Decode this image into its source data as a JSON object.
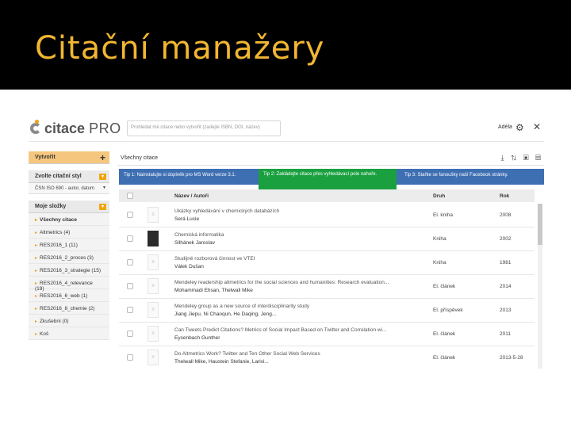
{
  "slide": {
    "title": "Citační manažery"
  },
  "app": {
    "logo_citace": "citace",
    "logo_pro": "PRO",
    "search_placeholder": "Prohledat mé citace nebo vytvořit (zadejte ISBN, DOI, název)",
    "user_name": "Adéla",
    "gear_icon": "⚙",
    "tools_icon": "✕"
  },
  "sidebar": {
    "create_label": "Vytvořit",
    "create_icon": "+",
    "style_label": "Zvolte citační styl",
    "style_value": "ČSN ISO 690 - autor, datum",
    "folders_label": "Moje složky",
    "folders": [
      "Všechny citace",
      "Altmetrics (4)",
      "RES2016_1 (11)",
      "RES2016_2_proces (3)",
      "RES2016_3_strategie (15)",
      "RES2016_4_relevance (19)",
      "RES2016_6_web (1)",
      "RES2016_8_chemie (2)",
      "Zkušební (0)",
      "Koš"
    ]
  },
  "main": {
    "heading": "Všechny citace",
    "toolbar_icons": "⤓ ⇅ ▣ ▤",
    "tips": [
      "Tip 1: Nainstalujte si doplněk pro MS Word verze 3.1.",
      "Tip 2: Zakládejte citace přes vyhledávací pole nahoře.",
      "Tip 3: Staňte se fanouškу naší Facebook stránky."
    ],
    "columns": {
      "name": "Název / Autoři",
      "type": "Druh",
      "year": "Rok"
    },
    "rows": [
      {
        "title": "Ukázky vyhledávání v chemických databázích",
        "authors": "Šerá Lucie",
        "type": "El. kniha",
        "year": "2008"
      },
      {
        "title": "Chemická informatika",
        "authors": "Šilhánek Jaroslav",
        "type": "Kniha",
        "year": "2002"
      },
      {
        "title": "Studijně rozborová činnost ve VTEI",
        "authors": "Válek Dušan",
        "type": "Kniha",
        "year": "1981"
      },
      {
        "title": "Mendeley readership altmetrics for the social sciences and humanities: Research evaluation...",
        "authors": "Mohammadi Ehsan, Thelwall Mike",
        "type": "El. článek",
        "year": "2014"
      },
      {
        "title": "Mendeley group as a new source of interdisciplinarity study",
        "authors": "Jiang Jiepu, Ni Chaoqun, He Daqing, Jeng...",
        "type": "El. příspěvek",
        "year": "2013"
      },
      {
        "title": "Can Tweets Predict Citations? Metrics of Social Impact Based on Twitter and Correlation wi...",
        "authors": "Eysenbach Gunther",
        "type": "El. článek",
        "year": "2011"
      },
      {
        "title": "Do Altmetrics Work? Twitter and Ten Other Social Web Services",
        "authors": "Thelwall Mike, Haustein Stefanie, Larivi...",
        "type": "El. článek",
        "year": "2013-5-28"
      }
    ]
  },
  "colors": {
    "title": "#f2b632",
    "accent": "#f0a30a",
    "tips_blue": "#3e6fb3",
    "tip_green": "#1aa03f"
  }
}
